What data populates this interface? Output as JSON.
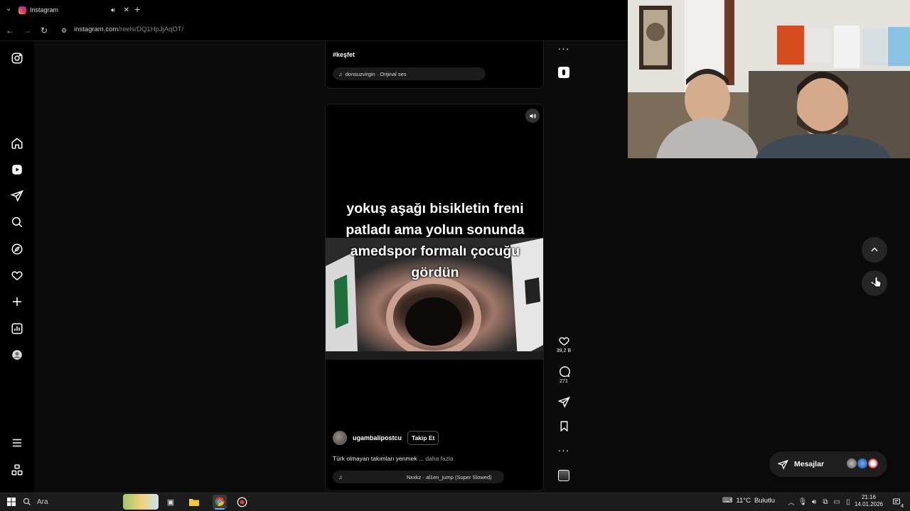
{
  "browser": {
    "tab_title": "Instagram",
    "url_host": "instagram.com",
    "url_path": "/reels/DQ1HpJjAqOT/"
  },
  "prev_reel": {
    "hashtag": "#keşfet",
    "audio": "donsuzvirgin · Orijinal ses"
  },
  "reel": {
    "overlay_text": "yokuş aşağı bisikletin freni patladı ama yolun sonunda amedspor formalı çocuğu gördün",
    "username": "ugambalipostcu",
    "follow_label": "Takip Et",
    "description": "Türk olmayan takımları yenmek ...",
    "more_label": "daha fazla",
    "audio": "Nxxkz · al1en_jump (Super Slowed)"
  },
  "actions": {
    "likes": "39,2 B",
    "comments": "271"
  },
  "messages": {
    "label": "Mesajlar"
  },
  "taskbar": {
    "search_placeholder": "Ara",
    "temperature": "11°C",
    "weather": "Bulutlu",
    "time": "21:16",
    "date": "14.01.2026",
    "notifications": "4"
  },
  "icons": {
    "rail": [
      "instagram-icon",
      "home-icon",
      "reels-icon",
      "send-icon",
      "search-icon",
      "explore-icon",
      "heart-icon",
      "create-icon",
      "insights-icon",
      "profile-icon",
      "menu-icon",
      "apps-icon"
    ]
  }
}
